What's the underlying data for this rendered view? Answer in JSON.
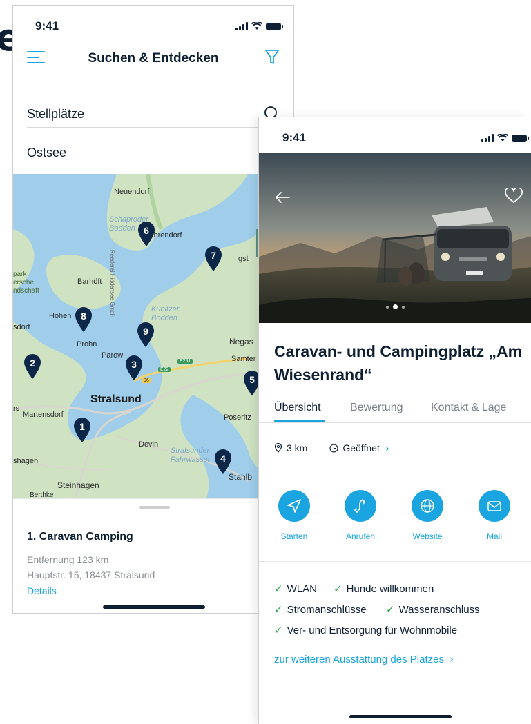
{
  "background_letter": "e",
  "phone1": {
    "status": {
      "time": "9:41"
    },
    "header": {
      "title": "Suchen & Entdecken"
    },
    "search": {
      "category_value": "Stellplätze",
      "region_value": "Ostsee"
    },
    "map": {
      "places": [
        "Neuendorf",
        "Schaproder Bodden",
        "Suhrendorf",
        "Barhöft",
        "Hohen",
        "sdorf",
        "Prohn",
        "Parow",
        "Kubitzer Bodden",
        "Negas",
        "Samter",
        "Stralsund",
        "Martensdorf",
        "Poseritz",
        "Devin",
        "Stralsunder Fahrwasser",
        "Stahlb",
        "shagen",
        "Steinhagen",
        "Berthke",
        "Reederei Hiddensee GmbH",
        "park",
        "ersche",
        "ndschaft",
        "gst",
        "rs"
      ],
      "road_shields": [
        "96",
        "E22",
        "E251"
      ],
      "pins": [
        "1",
        "2",
        "3",
        "4",
        "5",
        "6",
        "7",
        "8",
        "9"
      ]
    },
    "result": {
      "title": "1. Caravan Camping",
      "distance": "Entfernung 123 km",
      "address": "Hauptstr. 15, 18437 Stralsund",
      "details_link": "Details"
    }
  },
  "phone2": {
    "status": {
      "time": "9:41"
    },
    "carousel": {
      "slide_count": 3,
      "active_slide": 2
    },
    "title": "Caravan- und Campingplatz „Am Wiesenrand“",
    "tabs": [
      "Übersicht",
      "Bewertung",
      "Kontakt & Lage"
    ],
    "active_tab": "Übersicht",
    "info": {
      "distance": "3 km",
      "opening": "Geöffnet"
    },
    "actions": [
      "Starten",
      "Anrufen",
      "Website",
      "Mail"
    ],
    "features": [
      "WLAN",
      "Hunde willkommen",
      "Stromanschlüsse",
      "Wasseranschluss",
      "Ver- und Entsorgung für Wohnmobile"
    ],
    "more_link": "zur weiteren Ausstattung des Platzes"
  },
  "colors": {
    "accent": "#1aa5e0",
    "navy": "#0f1f33",
    "pin": "#0c2747",
    "check": "#2ea84a"
  }
}
